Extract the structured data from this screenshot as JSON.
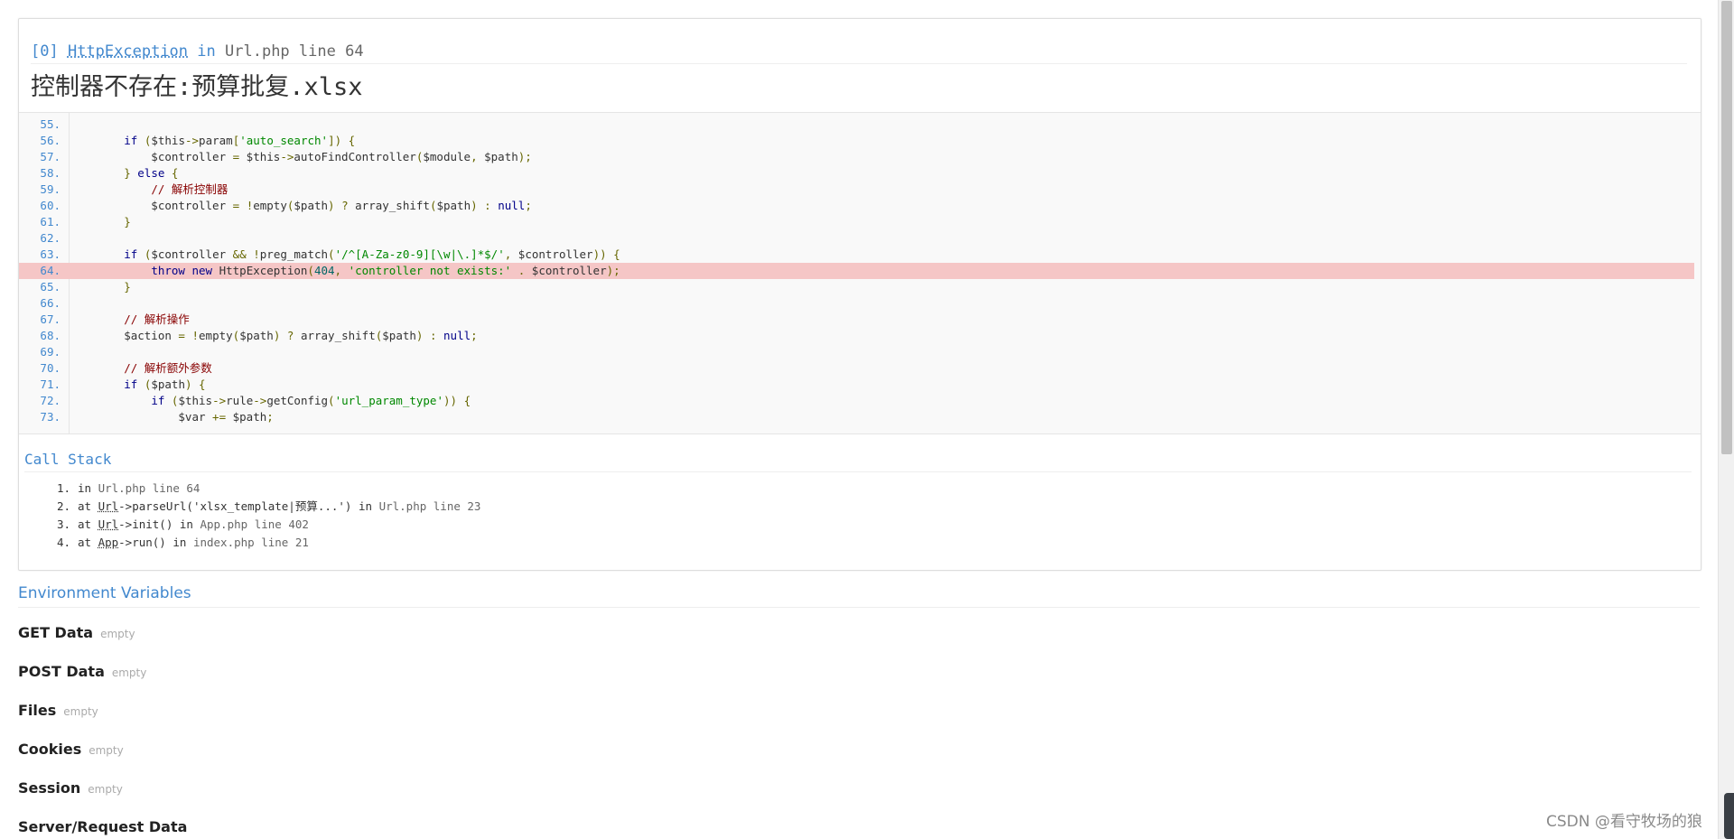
{
  "exception": {
    "index": "[0]",
    "class_name": "HttpException",
    "in_text": "in",
    "file": "Url.php",
    "line_text": "line 64",
    "message": "控制器不存在:预算批复.xlsx"
  },
  "source": {
    "highlight_line": 64,
    "lines": [
      {
        "no": "55.",
        "code": ""
      },
      {
        "no": "56.",
        "code": "        if ($this->param['auto_search']) {"
      },
      {
        "no": "57.",
        "code": "            $controller = $this->autoFindController($module, $path);"
      },
      {
        "no": "58.",
        "code": "        } else {"
      },
      {
        "no": "59.",
        "code": "            // 解析控制器"
      },
      {
        "no": "60.",
        "code": "            $controller = !empty($path) ? array_shift($path) : null;"
      },
      {
        "no": "61.",
        "code": "        }"
      },
      {
        "no": "62.",
        "code": ""
      },
      {
        "no": "63.",
        "code": "        if ($controller && !preg_match('/^[A-Za-z0-9][\\w|\\.]*$/', $controller)) {"
      },
      {
        "no": "64.",
        "code": "            throw new HttpException(404, 'controller not exists:' . $controller);"
      },
      {
        "no": "65.",
        "code": "        }"
      },
      {
        "no": "66.",
        "code": ""
      },
      {
        "no": "67.",
        "code": "        // 解析操作"
      },
      {
        "no": "68.",
        "code": "        $action = !empty($path) ? array_shift($path) : null;"
      },
      {
        "no": "69.",
        "code": ""
      },
      {
        "no": "70.",
        "code": "        // 解析额外参数"
      },
      {
        "no": "71.",
        "code": "        if ($path) {"
      },
      {
        "no": "72.",
        "code": "            if ($this->rule->getConfig('url_param_type')) {"
      },
      {
        "no": "73.",
        "code": "                $var += $path;"
      }
    ]
  },
  "call_stack": {
    "title": "Call Stack",
    "items": [
      {
        "index": "1.",
        "pre": "in ",
        "cls": "",
        "call": "",
        "mid": "",
        "loc": "Url.php line 64"
      },
      {
        "index": "2.",
        "pre": "at ",
        "cls": "Url",
        "call": "->parseUrl('xlsx_template|预算...')",
        "mid": " in ",
        "loc": "Url.php line 23"
      },
      {
        "index": "3.",
        "pre": "at ",
        "cls": "Url",
        "call": "->init()",
        "mid": " in ",
        "loc": "App.php line 402"
      },
      {
        "index": "4.",
        "pre": "at ",
        "cls": "App",
        "call": "->run()",
        "mid": " in ",
        "loc": "index.php line 21"
      }
    ]
  },
  "environment": {
    "title": "Environment Variables",
    "empty_label": "empty",
    "sections": [
      {
        "name": "GET Data",
        "empty": "empty"
      },
      {
        "name": "POST Data",
        "empty": "empty"
      },
      {
        "name": "Files",
        "empty": "empty"
      },
      {
        "name": "Cookies",
        "empty": "empty"
      },
      {
        "name": "Session",
        "empty": "empty"
      },
      {
        "name": "Server/Request Data",
        "empty": ""
      }
    ]
  },
  "watermark": "CSDN @看守牧场的狼",
  "colors": {
    "link_blue": "#4288ce",
    "highlight_row": "#f5c6c6",
    "code_bg": "#f9f9f9"
  }
}
